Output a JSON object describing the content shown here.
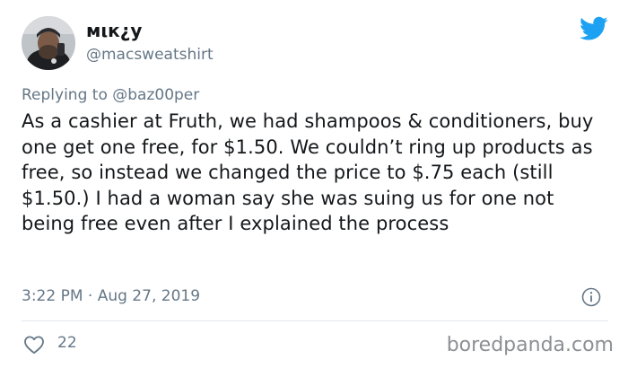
{
  "author": {
    "display_name": "мιк¿у",
    "handle": "@macsweatshirt",
    "avatar_icon": "user-avatar-photo"
  },
  "reply": {
    "prefix": "Replying to",
    "mention": "@baz00per"
  },
  "tweet": {
    "text": "As a cashier at Fruth, we had shampoos & conditioners, buy one get one free, for $1.50. We couldn’t ring up products as free, so instead we changed the price to $.75 each (still $1.50.) I had a woman say she was suing us for one not being free even after I explained the process",
    "timestamp": "3:22 PM · Aug 27, 2019"
  },
  "actions": {
    "likes": "22",
    "like_icon": "heart-icon",
    "info_icon": "info-icon"
  },
  "branding": {
    "twitter_icon": "twitter-bird-icon",
    "twitter_color": "#1da1f2",
    "watermark": "boredpanda.com"
  }
}
